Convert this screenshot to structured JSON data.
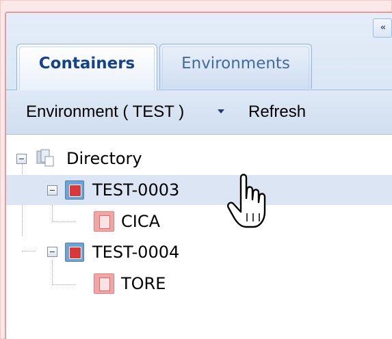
{
  "tabs": [
    {
      "label": "Containers",
      "active": true
    },
    {
      "label": "Environments",
      "active": false
    }
  ],
  "collapse_button": {
    "glyph": "«"
  },
  "toolbar": {
    "environment_label": "Environment ( TEST )",
    "refresh_label": "Refresh"
  },
  "tree": {
    "root": {
      "label": "Directory",
      "icon": "directory-icon"
    },
    "nodes": [
      {
        "label": "TEST-0003",
        "icon": "server-icon",
        "selected": true,
        "children": [
          {
            "label": "CICA",
            "icon": "container-icon"
          }
        ]
      },
      {
        "label": "TEST-0004",
        "icon": "server-icon",
        "selected": false,
        "children": [
          {
            "label": "TORE",
            "icon": "container-icon"
          }
        ]
      }
    ]
  },
  "colors": {
    "frame_border": "#e89a9a",
    "header_bg": "#d6e3f3",
    "active_tab_text": "#15428b",
    "inactive_tab_text": "#416aa3",
    "selected_row": "#dbe5f3",
    "server_icon": "#d8383a",
    "container_icon": "#f2a5a5"
  }
}
